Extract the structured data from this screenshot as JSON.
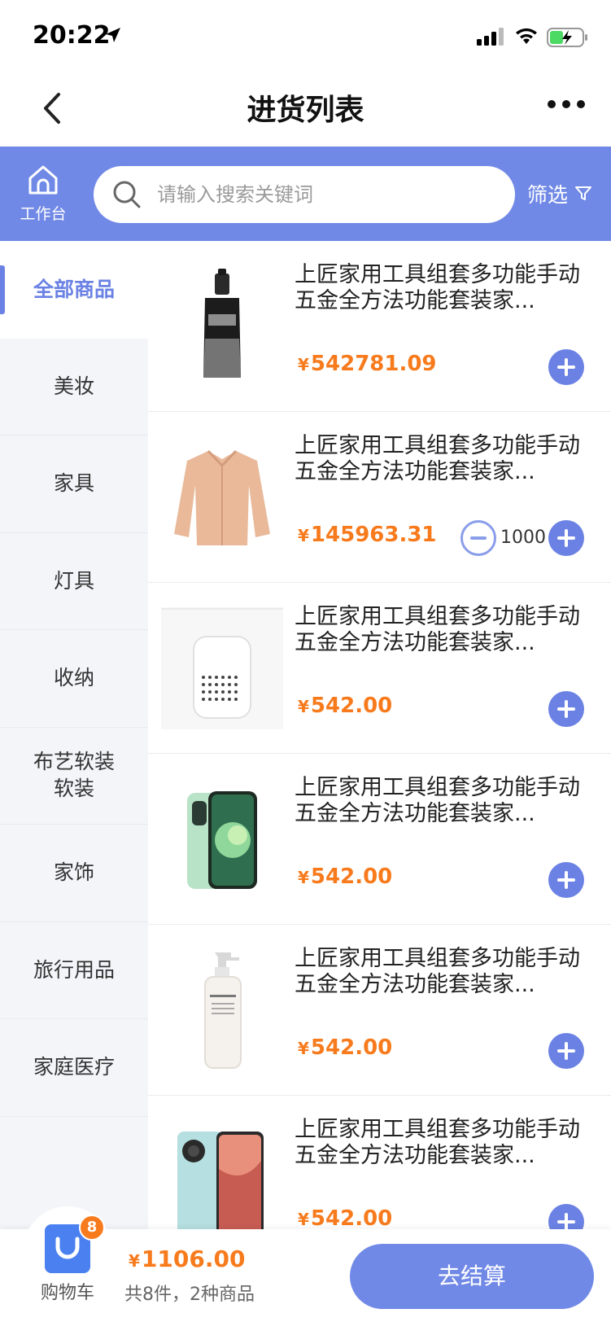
{
  "status_bar": {
    "time": "20:22"
  },
  "nav": {
    "title": "进货列表"
  },
  "header": {
    "workbench_label": "工作台",
    "search_placeholder": "请输入搜索关键词",
    "filter_label": "筛选"
  },
  "categories": [
    {
      "label": "全部商品",
      "active": true
    },
    {
      "label": "美妆"
    },
    {
      "label": "家具"
    },
    {
      "label": "灯具"
    },
    {
      "label": "收纳"
    },
    {
      "label": "布艺软装\n软装"
    },
    {
      "label": "家饰"
    },
    {
      "label": "旅行用品"
    },
    {
      "label": "家庭医疗"
    }
  ],
  "products": [
    {
      "title": "上匠家用工具组套多功能手动五金全方法功能套装家...",
      "currency": "¥",
      "price": "542781.09",
      "image": "serum-bottle"
    },
    {
      "title": "上匠家用工具组套多功能手动五金全方法功能套装家...",
      "currency": "¥",
      "price": "145963.31",
      "image": "silk-shirt",
      "quantity": "1000"
    },
    {
      "title": "上匠家用工具组套多功能手动五金全方法功能套装家...",
      "currency": "¥",
      "price": "542.00",
      "image": "air-purifier"
    },
    {
      "title": "上匠家用工具组套多功能手动五金全方法功能套装家...",
      "currency": "¥",
      "price": "542.00",
      "image": "green-phone"
    },
    {
      "title": "上匠家用工具组套多功能手动五金全方法功能套装家...",
      "currency": "¥",
      "price": "542.00",
      "image": "lotion-bottle"
    },
    {
      "title": "上匠家用工具组套多功能手动五金全方法功能套装家...",
      "currency": "¥",
      "price": "542.00",
      "image": "smartphone"
    }
  ],
  "cart": {
    "label": "购物车",
    "badge": "8",
    "currency": "¥",
    "total": "1106.00",
    "summary": "共8件，2种商品",
    "checkout_label": "去结算"
  },
  "colors": {
    "accent": "#7189e6",
    "price": "#f77b1d"
  }
}
